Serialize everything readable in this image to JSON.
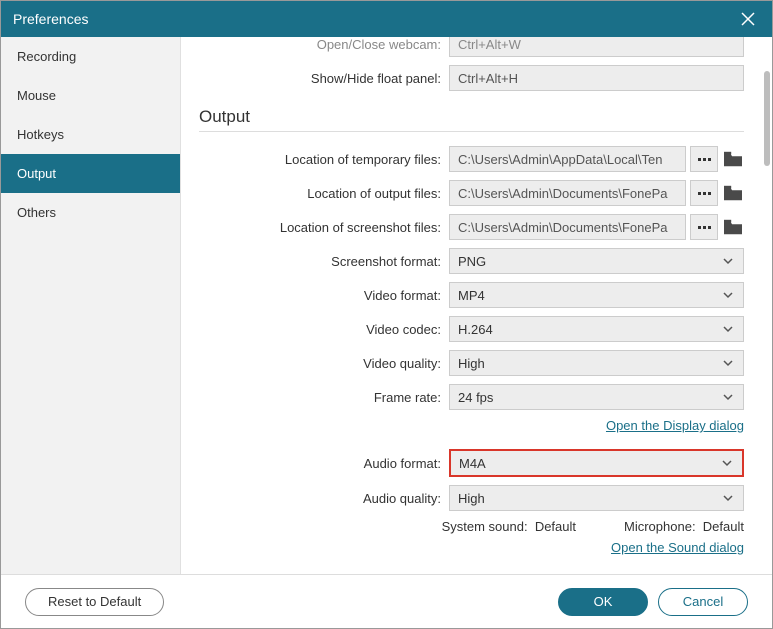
{
  "title": "Preferences",
  "sidebar": {
    "items": [
      {
        "label": "Recording"
      },
      {
        "label": "Mouse"
      },
      {
        "label": "Hotkeys"
      },
      {
        "label": "Output"
      },
      {
        "label": "Others"
      }
    ],
    "active": 3
  },
  "topCut": {
    "webcam": {
      "label": "Open/Close webcam:",
      "value": "Ctrl+Alt+W"
    },
    "floatPanel": {
      "label": "Show/Hide float panel:",
      "value": "Ctrl+Alt+H"
    }
  },
  "output": {
    "sectionTitle": "Output",
    "tempFiles": {
      "label": "Location of temporary files:",
      "value": "C:\\Users\\Admin\\AppData\\Local\\Ten"
    },
    "outputFiles": {
      "label": "Location of output files:",
      "value": "C:\\Users\\Admin\\Documents\\FonePa"
    },
    "screenshotFiles": {
      "label": "Location of screenshot files:",
      "value": "C:\\Users\\Admin\\Documents\\FonePa"
    },
    "screenshotFormat": {
      "label": "Screenshot format:",
      "value": "PNG"
    },
    "videoFormat": {
      "label": "Video format:",
      "value": "MP4"
    },
    "videoCodec": {
      "label": "Video codec:",
      "value": "H.264"
    },
    "videoQuality": {
      "label": "Video quality:",
      "value": "High"
    },
    "frameRate": {
      "label": "Frame rate:",
      "value": "24 fps"
    },
    "displayLink": "Open the Display dialog",
    "audioFormat": {
      "label": "Audio format:",
      "value": "M4A"
    },
    "audioQuality": {
      "label": "Audio quality:",
      "value": "High"
    },
    "systemSound": {
      "label": "System sound:",
      "value": "Default"
    },
    "microphone": {
      "label": "Microphone:",
      "value": "Default"
    },
    "soundLink": "Open the Sound dialog"
  },
  "footer": {
    "reset": "Reset to Default",
    "ok": "OK",
    "cancel": "Cancel"
  }
}
